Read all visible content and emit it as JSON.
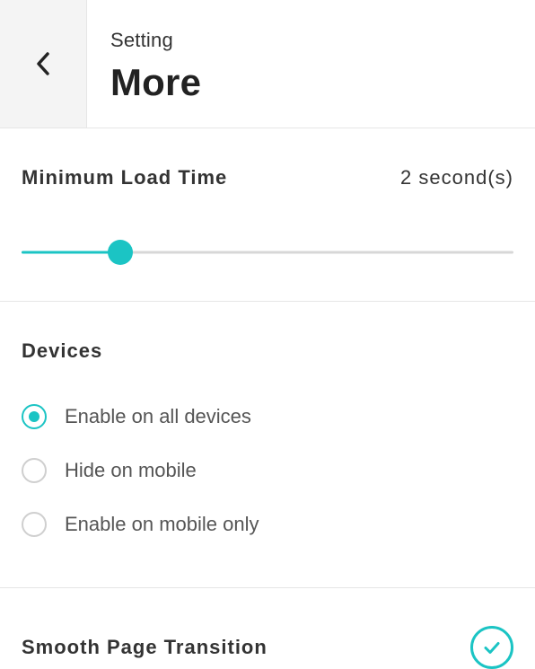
{
  "header": {
    "breadcrumb": "Setting",
    "title": "More"
  },
  "loadtime": {
    "label": "Minimum Load Time",
    "value_display": "2 second(s)",
    "value": 2,
    "min": 0,
    "max": 10,
    "fill_percent": 20
  },
  "devices": {
    "title": "Devices",
    "selected_index": 0,
    "options": [
      {
        "label": "Enable on all devices"
      },
      {
        "label": "Hide on mobile"
      },
      {
        "label": "Enable on mobile only"
      }
    ]
  },
  "smooth_transition": {
    "label": "Smooth Page Transition",
    "enabled": true
  },
  "colors": {
    "accent": "#1bc4c4",
    "track": "#d7d7d7",
    "border": "#e6e6e6"
  }
}
